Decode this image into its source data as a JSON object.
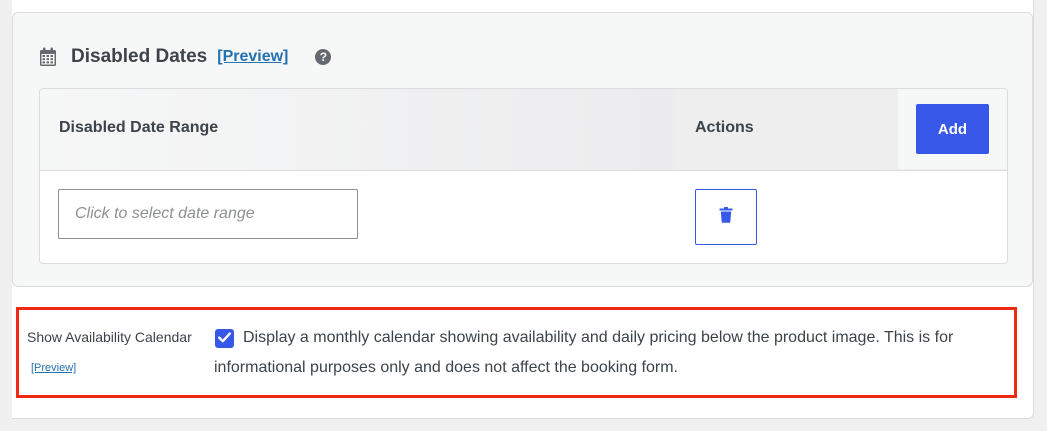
{
  "disabled_dates": {
    "title": "Disabled Dates",
    "preview_link": "[Preview]",
    "help_icon": "question-circle-icon",
    "calendar_icon": "calendar-icon",
    "table": {
      "columns": [
        "Disabled Date Range",
        "Actions"
      ],
      "add_label": "Add",
      "rows": [
        {
          "date_range_placeholder": "Click to select date range",
          "date_range_value": "",
          "delete_icon": "trash-icon"
        }
      ]
    }
  },
  "availability": {
    "label": "Show Availability Calendar",
    "preview_link": "[Preview]",
    "checked": true,
    "description": "Display a monthly calendar showing availability and daily pricing below the product image. This is for informational purposes only and does not affect the booking form."
  },
  "colors": {
    "accent": "#3858e9",
    "link": "#2271b1",
    "highlight_border": "#ee2b12"
  }
}
